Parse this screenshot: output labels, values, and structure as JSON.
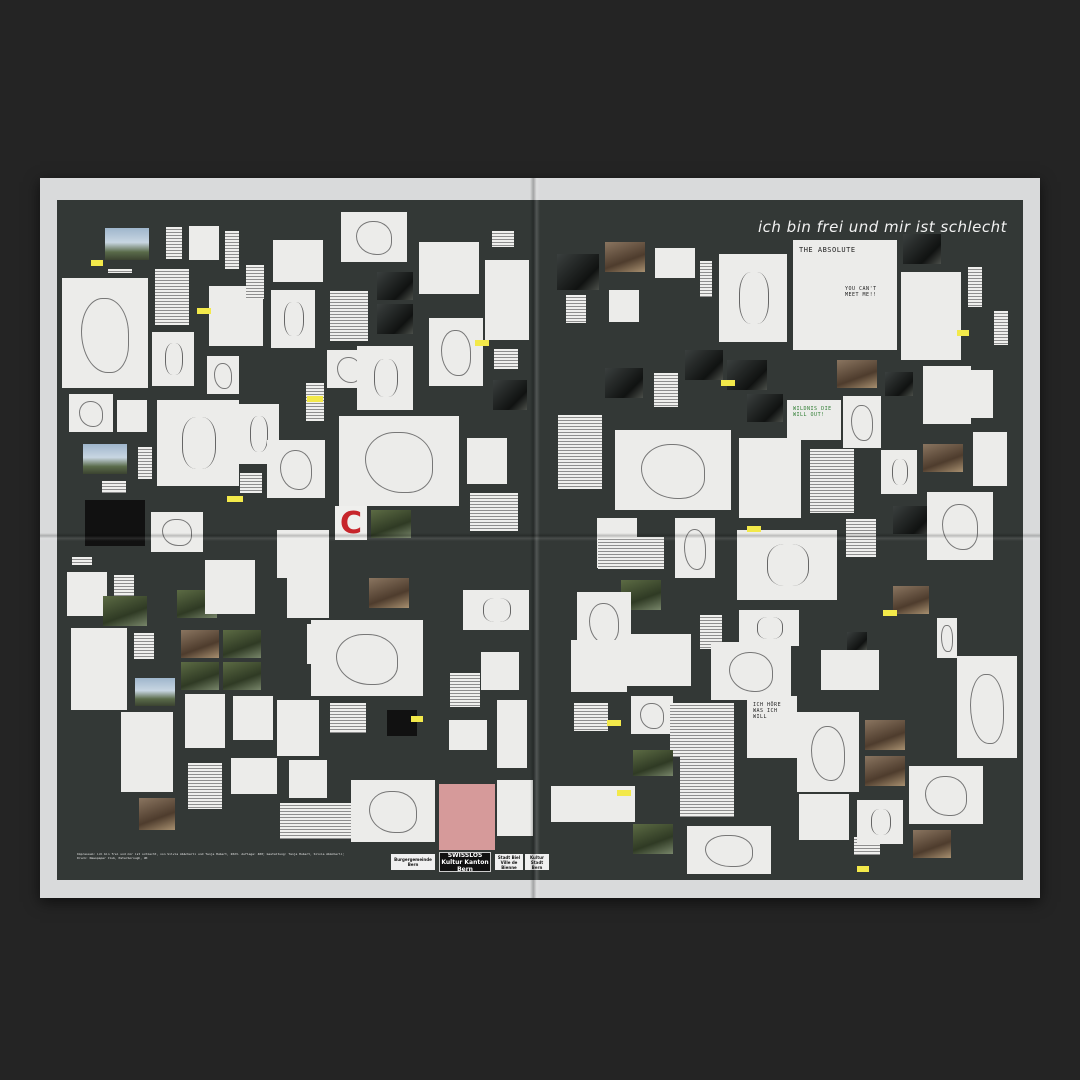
{
  "headline": "ich bin frei und mir ist schlecht",
  "tile_texts": {
    "the_absolute": "THE ABSOLUTE",
    "cant_meet_me": "YOU CAN'T MEET ME!!",
    "what_you_want_out": "WILDNIS DIE WILL OUT!",
    "ich_hoere": "ICH HÖRE WAS ICH WILL"
  },
  "credits": "Impressum: ich bin frei und mir ist schlecht, von Silvia Abächerli und Tanja Hubert, 2023. Auflage: 400; Gestaltung: Tanja Hubert, Silvia Abächerli; Druck: Newspaper Club, Peterborough, UK",
  "logos": {
    "burgergemeinde": "Burgergemeinde Bern",
    "swisslos": "SWISSLOS Kultur Kanton Bern",
    "stadt_biel": "Stadt Biel Ville de Bienne",
    "kultur_stadt_bern": "Kultur Stadt Bern"
  },
  "colors": {
    "background": "#242424",
    "sheet": "#d9dadb",
    "panel": "#333836",
    "accent_yellow": "#f3e94a",
    "accent_red": "#c7252b"
  }
}
